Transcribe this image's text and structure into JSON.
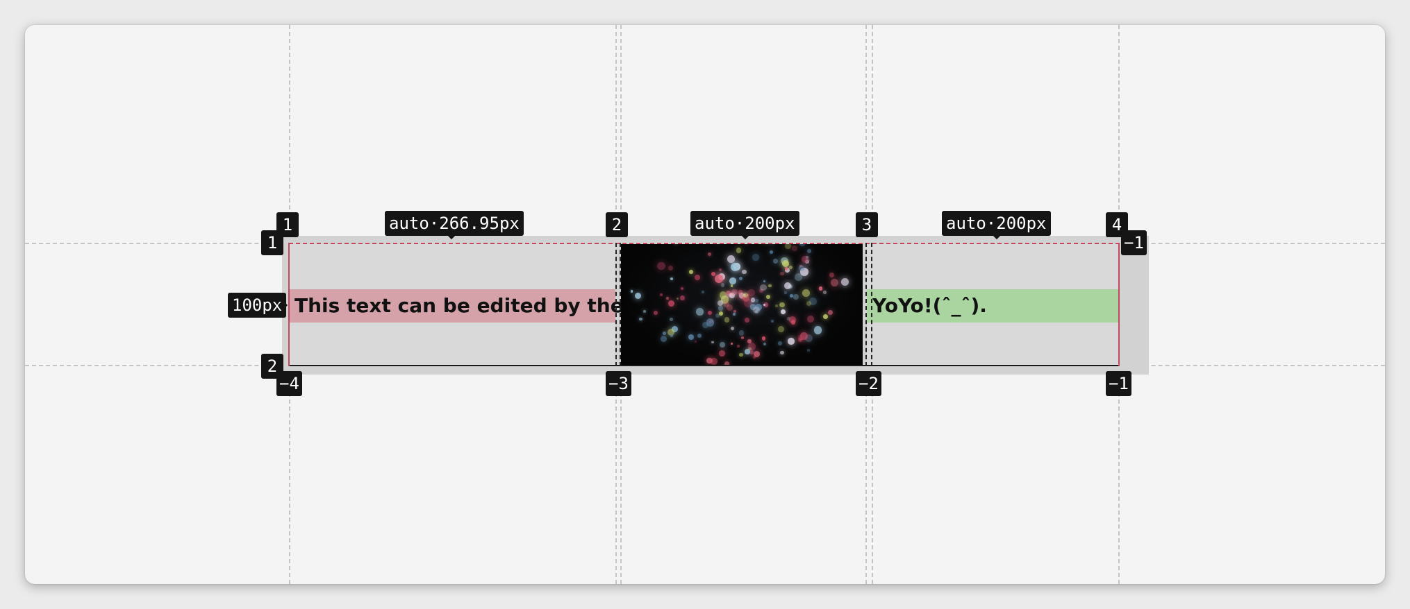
{
  "cells": {
    "editable_text": "This text can be edited by the user.",
    "green_text": "YoYo!(ˆ_ˆ)."
  },
  "overlay": {
    "col_sizes": [
      "auto·266.95px",
      "auto·200px",
      "auto·200px"
    ],
    "row_size": "100px",
    "col_lines_positive": [
      "1",
      "2",
      "3",
      "4"
    ],
    "col_lines_negative": [
      "−4",
      "−3",
      "−2",
      "−1"
    ],
    "row_lines_positive": [
      "1",
      "2"
    ],
    "row_lines_negative": [
      "−1"
    ]
  },
  "colors": {
    "editable_bg": "#d4a2a8",
    "green_bg": "#abd5a0",
    "badge_bg": "#151515",
    "grid_line": "#c24860"
  }
}
